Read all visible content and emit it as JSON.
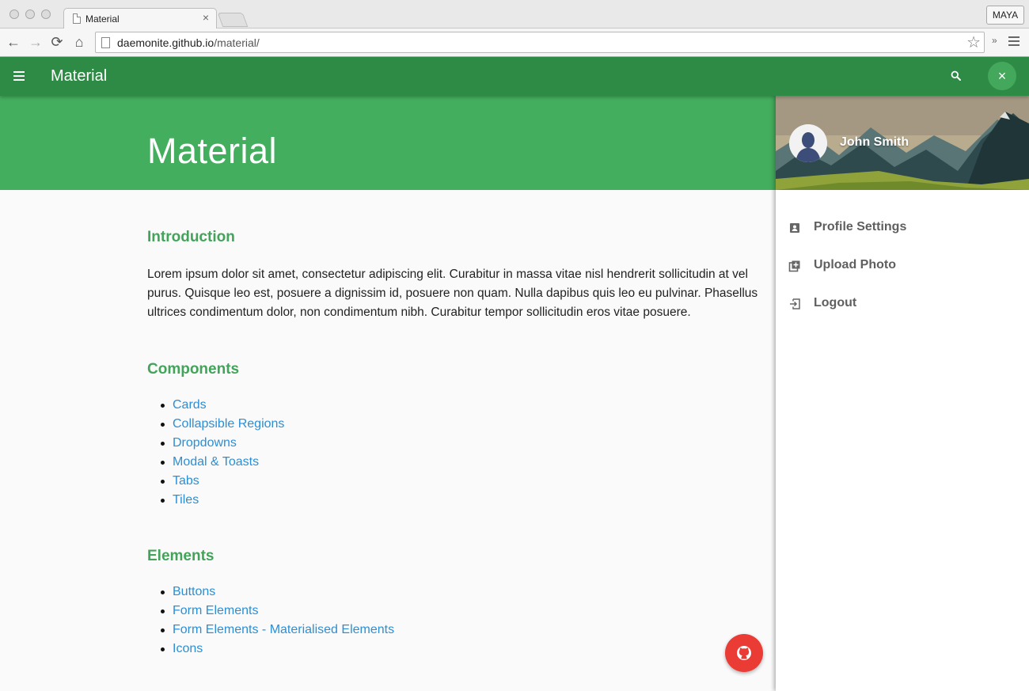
{
  "browser": {
    "tab_title": "Material",
    "tab_close": "×",
    "profile": "MAYA",
    "url_host": "daemonite.github.io",
    "url_path": "/material/",
    "back_icon": "←",
    "forward_icon": "→",
    "reload_icon": "⟳",
    "home_icon": "⌂",
    "star_icon": "☆",
    "extensions_icon": "»"
  },
  "appbar": {
    "title": "Material",
    "close_icon": "×",
    "accent": "#2e8b45"
  },
  "hero": {
    "title": "Material",
    "color": "#43ae5d"
  },
  "intro": {
    "heading": "Introduction",
    "text": "Lorem ipsum dolor sit amet, consectetur adipiscing elit. Curabitur in massa vitae nisl hendrerit sollicitudin at vel purus. Quisque leo est, posuere a dignissim id, posuere non quam. Nulla dapibus quis leo eu pulvinar. Phasellus ultrices condimentum dolor, non condimentum nibh. Curabitur tempor sollicitudin eros vitae posuere."
  },
  "components": {
    "heading": "Components",
    "items": [
      "Cards",
      "Collapsible Regions",
      "Dropdowns",
      "Modal & Toasts",
      "Tabs",
      "Tiles"
    ]
  },
  "elements": {
    "heading": "Elements",
    "items": [
      "Buttons",
      "Form Elements",
      "Form Elements - Materialised Elements",
      "Icons"
    ]
  },
  "drawer": {
    "user_name": "John Smith",
    "items": [
      {
        "label": "Profile Settings",
        "icon": "account-box-icon"
      },
      {
        "label": "Upload Photo",
        "icon": "add-to-photos-icon"
      },
      {
        "label": "Logout",
        "icon": "exit-to-app-icon"
      }
    ]
  },
  "fab": {
    "icon": "github-icon",
    "color": "#ea3b35"
  }
}
